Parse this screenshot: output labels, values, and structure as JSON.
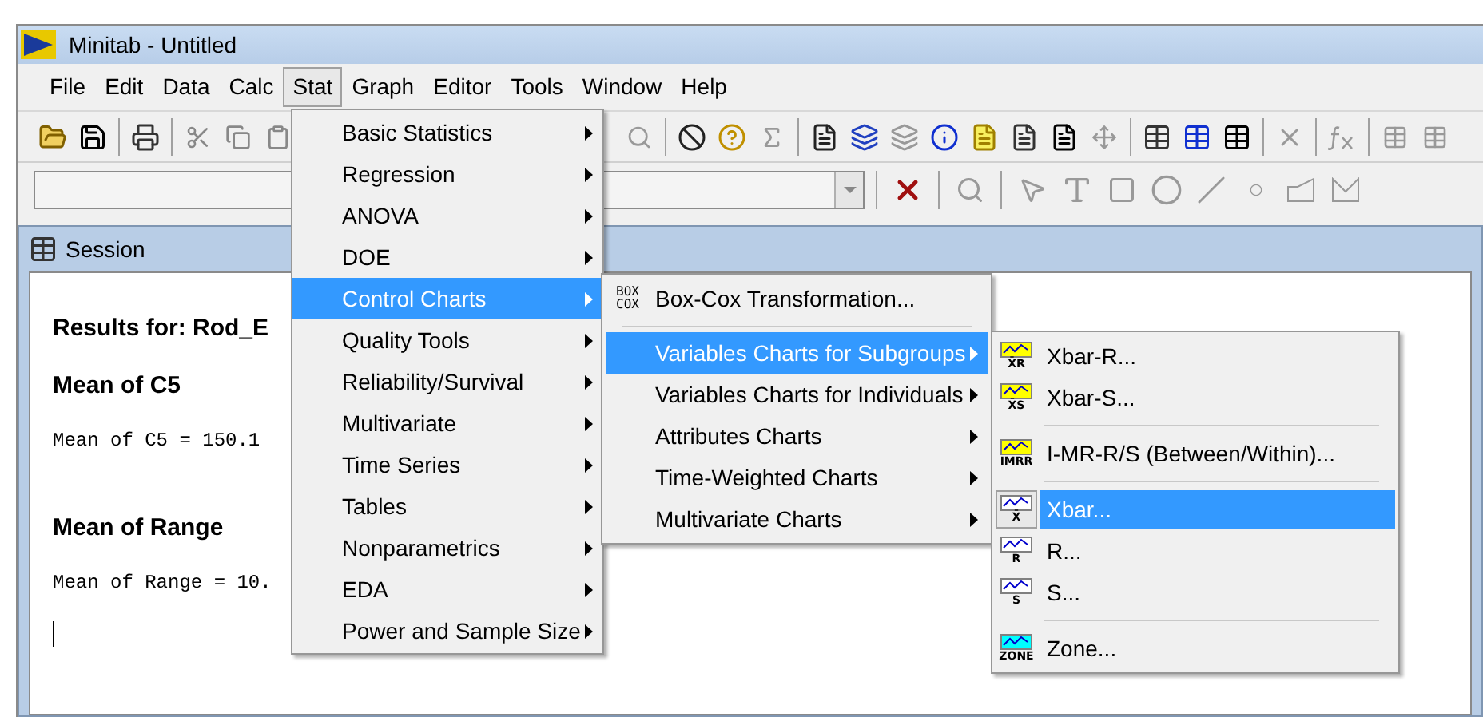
{
  "window": {
    "title": "Minitab - Untitled"
  },
  "menu_bar": [
    {
      "label": "File",
      "selected": false
    },
    {
      "label": "Edit",
      "selected": false
    },
    {
      "label": "Data",
      "selected": false
    },
    {
      "label": "Calc",
      "selected": false
    },
    {
      "label": "Stat",
      "selected": true
    },
    {
      "label": "Graph",
      "selected": false
    },
    {
      "label": "Editor",
      "selected": false
    },
    {
      "label": "Tools",
      "selected": false
    },
    {
      "label": "Window",
      "selected": false
    },
    {
      "label": "Help",
      "selected": false
    }
  ],
  "session": {
    "title": "Session",
    "lines": [
      {
        "kind": "heading",
        "text": "Results for: Rod_E"
      },
      {
        "kind": "heading",
        "text": "Mean of C5"
      },
      {
        "kind": "output",
        "text": "Mean of C5 = 150.1"
      },
      {
        "kind": "heading",
        "text": "Mean of Range"
      },
      {
        "kind": "output",
        "text": "Mean of Range = 10."
      }
    ]
  },
  "stat_menu": {
    "items": [
      {
        "label": "Basic Statistics",
        "selected": false
      },
      {
        "label": "Regression",
        "selected": false
      },
      {
        "label": "ANOVA",
        "selected": false
      },
      {
        "label": "DOE",
        "selected": false
      },
      {
        "label": "Control Charts",
        "selected": true
      },
      {
        "label": "Quality Tools",
        "selected": false
      },
      {
        "label": "Reliability/Survival",
        "selected": false
      },
      {
        "label": "Multivariate",
        "selected": false
      },
      {
        "label": "Time Series",
        "selected": false
      },
      {
        "label": "Tables",
        "selected": false
      },
      {
        "label": "Nonparametrics",
        "selected": false
      },
      {
        "label": "EDA",
        "selected": false
      },
      {
        "label": "Power and Sample Size",
        "selected": false
      }
    ]
  },
  "control_charts_menu": {
    "items": [
      {
        "kind": "command",
        "icon_label": "BOX COX",
        "label": "Box-Cox Transformation...",
        "selected": false
      },
      {
        "kind": "separator"
      },
      {
        "kind": "submenu",
        "label": "Variables Charts for Subgroups",
        "selected": true
      },
      {
        "kind": "submenu",
        "label": "Variables Charts for Individuals",
        "selected": false
      },
      {
        "kind": "submenu",
        "label": "Attributes Charts",
        "selected": false
      },
      {
        "kind": "submenu",
        "label": "Time-Weighted Charts",
        "selected": false
      },
      {
        "kind": "submenu",
        "label": "Multivariate Charts",
        "selected": false
      }
    ]
  },
  "subgroups_menu": {
    "items": [
      {
        "kind": "command",
        "icon_label": "X̄R",
        "color": "#ffff00",
        "label": "Xbar-R...",
        "selected": false
      },
      {
        "kind": "command",
        "icon_label": "X̄S",
        "color": "#ffff00",
        "label": "Xbar-S...",
        "selected": false
      },
      {
        "kind": "separator"
      },
      {
        "kind": "command",
        "icon_label": "IMRR",
        "color": "#ffff00",
        "label": "I-MR-R/S (Between/Within)...",
        "selected": false
      },
      {
        "kind": "separator"
      },
      {
        "kind": "command",
        "icon_label": "X̄",
        "color": "#ffffff",
        "label": "Xbar...",
        "selected": true
      },
      {
        "kind": "command",
        "icon_label": "R",
        "color": "#ffffff",
        "label": "R...",
        "selected": false
      },
      {
        "kind": "command",
        "icon_label": "S",
        "color": "#ffffff",
        "label": "S...",
        "selected": false
      },
      {
        "kind": "separator"
      },
      {
        "kind": "command",
        "icon_label": "ZONE",
        "color": "#00ffff",
        "label": "Zone...",
        "selected": false
      }
    ]
  }
}
